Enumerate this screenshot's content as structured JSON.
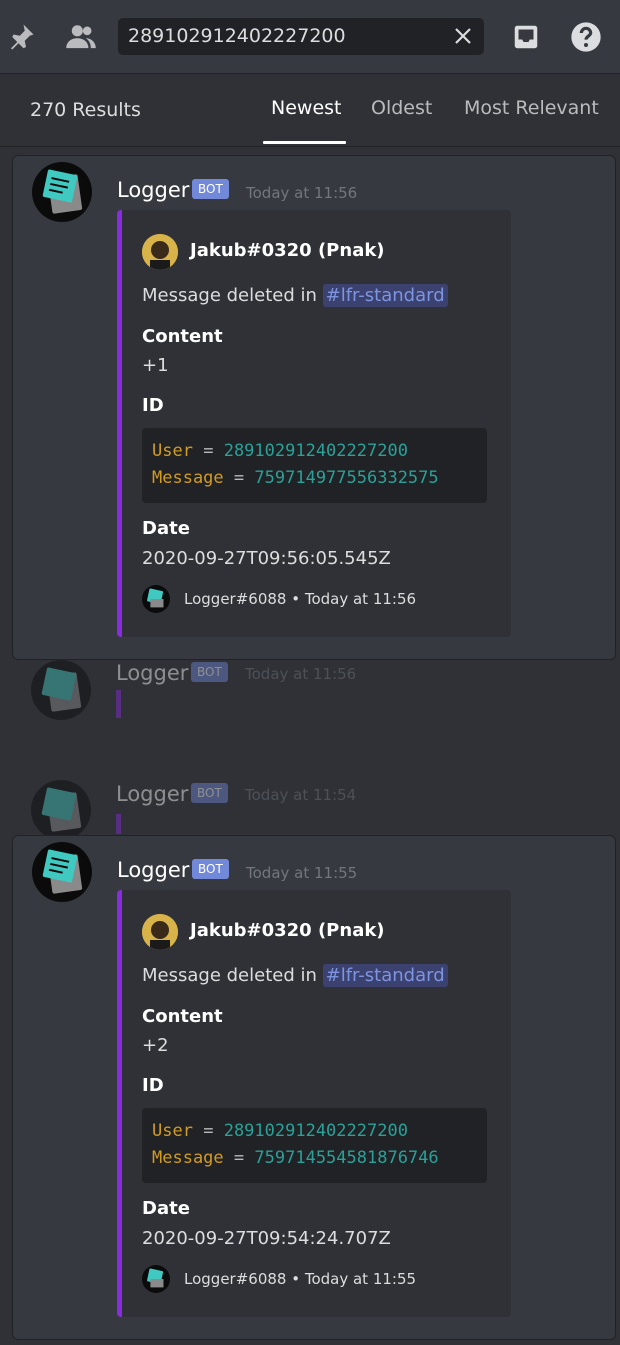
{
  "search": {
    "value": "289102912402227200"
  },
  "results": {
    "count_label": "270 Results",
    "tabs": [
      "Newest",
      "Oldest",
      "Most Relevant"
    ]
  },
  "messages": [
    {
      "author": "Logger",
      "badge": "BOT",
      "timestamp": "Today at 11:56",
      "embed": {
        "author": "Jakub#0320 (Pnak)",
        "desc_prefix": "Message deleted in ",
        "channel": "#lfr-standard",
        "content_label": "Content",
        "content": "+1",
        "id_label": "ID",
        "user_key": "User",
        "user_id": "289102912402227200",
        "msg_key": "Message",
        "msg_id": "759714977556332575",
        "date_label": "Date",
        "date": "2020-09-27T09:56:05.545Z",
        "footer": "Logger#6088 • Today at 11:56"
      }
    },
    {
      "author": "Logger",
      "badge": "BOT",
      "timestamp": "Today at 11:55",
      "embed": {
        "author": "Jakub#0320 (Pnak)",
        "desc_prefix": "Message deleted in ",
        "channel": "#lfr-standard",
        "content_label": "Content",
        "content": "+2",
        "id_label": "ID",
        "user_key": "User",
        "user_id": "289102912402227200",
        "msg_key": "Message",
        "msg_id": "759714554581876746",
        "date_label": "Date",
        "date": "2020-09-27T09:54:24.707Z",
        "footer": "Logger#6088 • Today at 11:55"
      }
    }
  ],
  "context": [
    {
      "author": "Logger",
      "badge": "BOT",
      "timestamp": "Today at 11:56"
    },
    {
      "author": "Logger",
      "badge": "BOT",
      "timestamp": "Today at 11:54"
    }
  ],
  "icons": [
    "pin-icon",
    "members-icon",
    "clear-icon",
    "inbox-icon",
    "help-icon"
  ],
  "colors": {
    "accent": "#7289da",
    "embed_bar": "#8a2be2",
    "keyword": "#d29b22",
    "number": "#2aa198"
  }
}
